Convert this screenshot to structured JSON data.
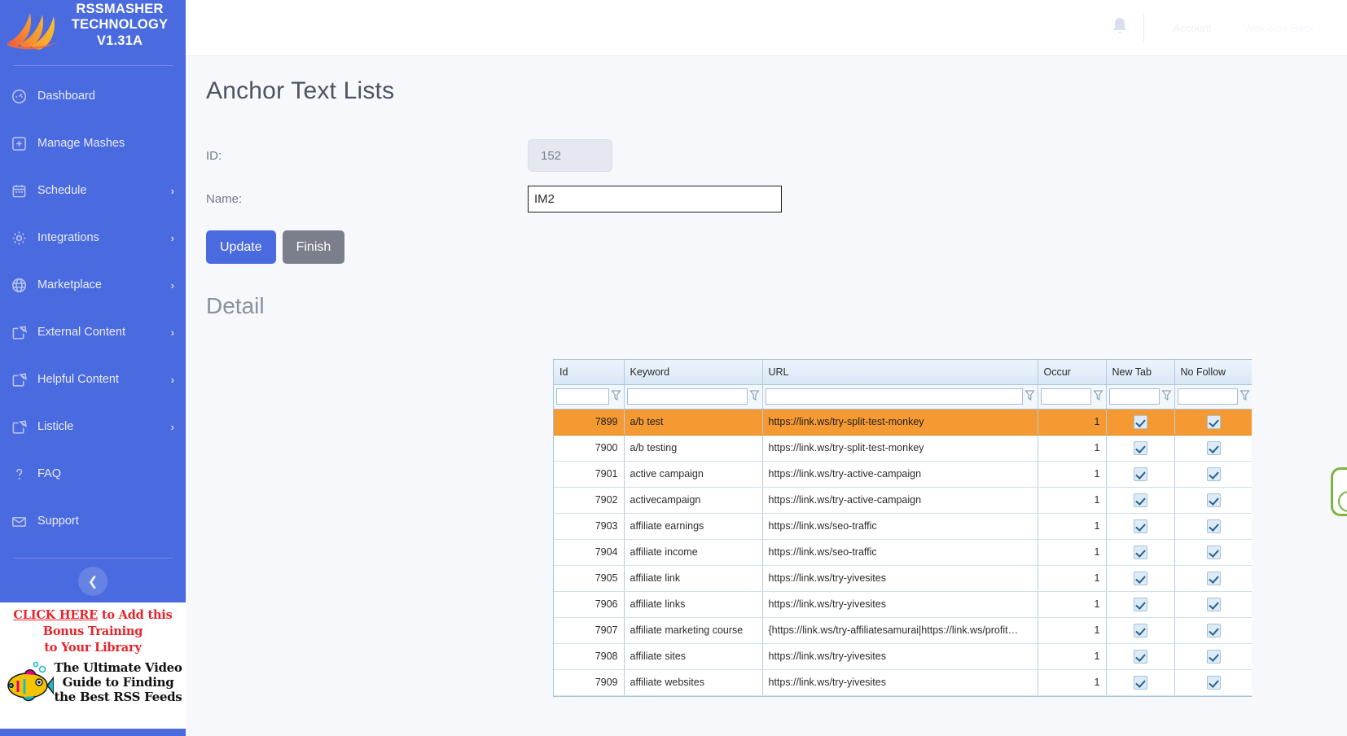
{
  "sidebar": {
    "brand": {
      "line1": "RSSMASHER",
      "line2": "TECHNOLOGY",
      "line3": "V1.31A",
      "logo_icon": "rssmasher-flame-logo"
    },
    "items": [
      {
        "label": "Dashboard",
        "icon": "dashboard-icon",
        "chevron": ""
      },
      {
        "label": "Manage Mashes",
        "icon": "grid-plus-icon",
        "chevron": ""
      },
      {
        "label": "Schedule",
        "icon": "calendar-icon",
        "chevron": "›"
      },
      {
        "label": "Integrations",
        "icon": "gear-icon",
        "chevron": "›"
      },
      {
        "label": "Marketplace",
        "icon": "globe-icon",
        "chevron": "›"
      },
      {
        "label": "External Content",
        "icon": "edit-square-icon",
        "chevron": "›"
      },
      {
        "label": "Helpful Content",
        "icon": "edit-square-icon",
        "chevron": "›"
      },
      {
        "label": "Listicle",
        "icon": "edit-square-icon",
        "chevron": "›"
      },
      {
        "label": "FAQ",
        "icon": "question-icon",
        "chevron": ""
      },
      {
        "label": "Support",
        "icon": "envelope-icon",
        "chevron": ""
      }
    ],
    "collapse_icon": "chevron-left-icon",
    "promo": {
      "line1_link": "CLICK HERE",
      "line1_rest": " to Add this Bonus Training",
      "line2": "to Your Library",
      "headline": "The Ultimate Video Guide to Finding the Best RSS Feeds",
      "image_icon": "fish-illustration"
    },
    "accent_color": "#4a6ae0"
  },
  "topbar": {
    "bell_icon": "notification-bell-icon",
    "faint_label_1": "Account",
    "faint_label_2": "Welcome Back"
  },
  "main": {
    "page_title": "Anchor Text Lists",
    "fields": {
      "id_label": "ID:",
      "id_value": "152",
      "name_label": "Name:",
      "name_value": "IM2",
      "name_placeholder": ""
    },
    "buttons": {
      "update": "Update",
      "finish": "Finish"
    },
    "detail_title": "Detail"
  },
  "grid": {
    "columns": [
      "Id",
      "Keyword",
      "URL",
      "Occur",
      "New Tab",
      "No Follow"
    ],
    "filters": [
      "",
      "",
      "",
      "",
      "",
      ""
    ],
    "filter_icon": "funnel-filter-icon",
    "selected_row_color": "#f59a33",
    "rows": [
      {
        "id": "7899",
        "keyword": "a/b test",
        "url": "https://link.ws/try-split-test-monkey",
        "occur": "1",
        "new_tab": true,
        "no_follow": true,
        "selected": true
      },
      {
        "id": "7900",
        "keyword": "a/b testing",
        "url": "https://link.ws/try-split-test-monkey",
        "occur": "1",
        "new_tab": true,
        "no_follow": true,
        "selected": false
      },
      {
        "id": "7901",
        "keyword": "active campaign",
        "url": "https://link.ws/try-active-campaign",
        "occur": "1",
        "new_tab": true,
        "no_follow": true,
        "selected": false
      },
      {
        "id": "7902",
        "keyword": "activecampaign",
        "url": "https://link.ws/try-active-campaign",
        "occur": "1",
        "new_tab": true,
        "no_follow": true,
        "selected": false
      },
      {
        "id": "7903",
        "keyword": "affiliate earnings",
        "url": "https://link.ws/seo-traffic",
        "occur": "1",
        "new_tab": true,
        "no_follow": true,
        "selected": false
      },
      {
        "id": "7904",
        "keyword": "affiliate income",
        "url": "https://link.ws/seo-traffic",
        "occur": "1",
        "new_tab": true,
        "no_follow": true,
        "selected": false
      },
      {
        "id": "7905",
        "keyword": "affiliate link",
        "url": "https://link.ws/try-yivesites",
        "occur": "1",
        "new_tab": true,
        "no_follow": true,
        "selected": false
      },
      {
        "id": "7906",
        "keyword": "affiliate links",
        "url": "https://link.ws/try-yivesites",
        "occur": "1",
        "new_tab": true,
        "no_follow": true,
        "selected": false
      },
      {
        "id": "7907",
        "keyword": "affiliate marketing course",
        "url": "{https://link.ws/try-affiliatesamurai|https://link.ws/profit…",
        "occur": "1",
        "new_tab": true,
        "no_follow": true,
        "selected": false
      },
      {
        "id": "7908",
        "keyword": "affiliate sites",
        "url": "https://link.ws/try-yivesites",
        "occur": "1",
        "new_tab": true,
        "no_follow": true,
        "selected": false
      },
      {
        "id": "7909",
        "keyword": "affiliate websites",
        "url": "https://link.ws/try-yivesites",
        "occur": "1",
        "new_tab": true,
        "no_follow": true,
        "selected": false
      }
    ]
  }
}
